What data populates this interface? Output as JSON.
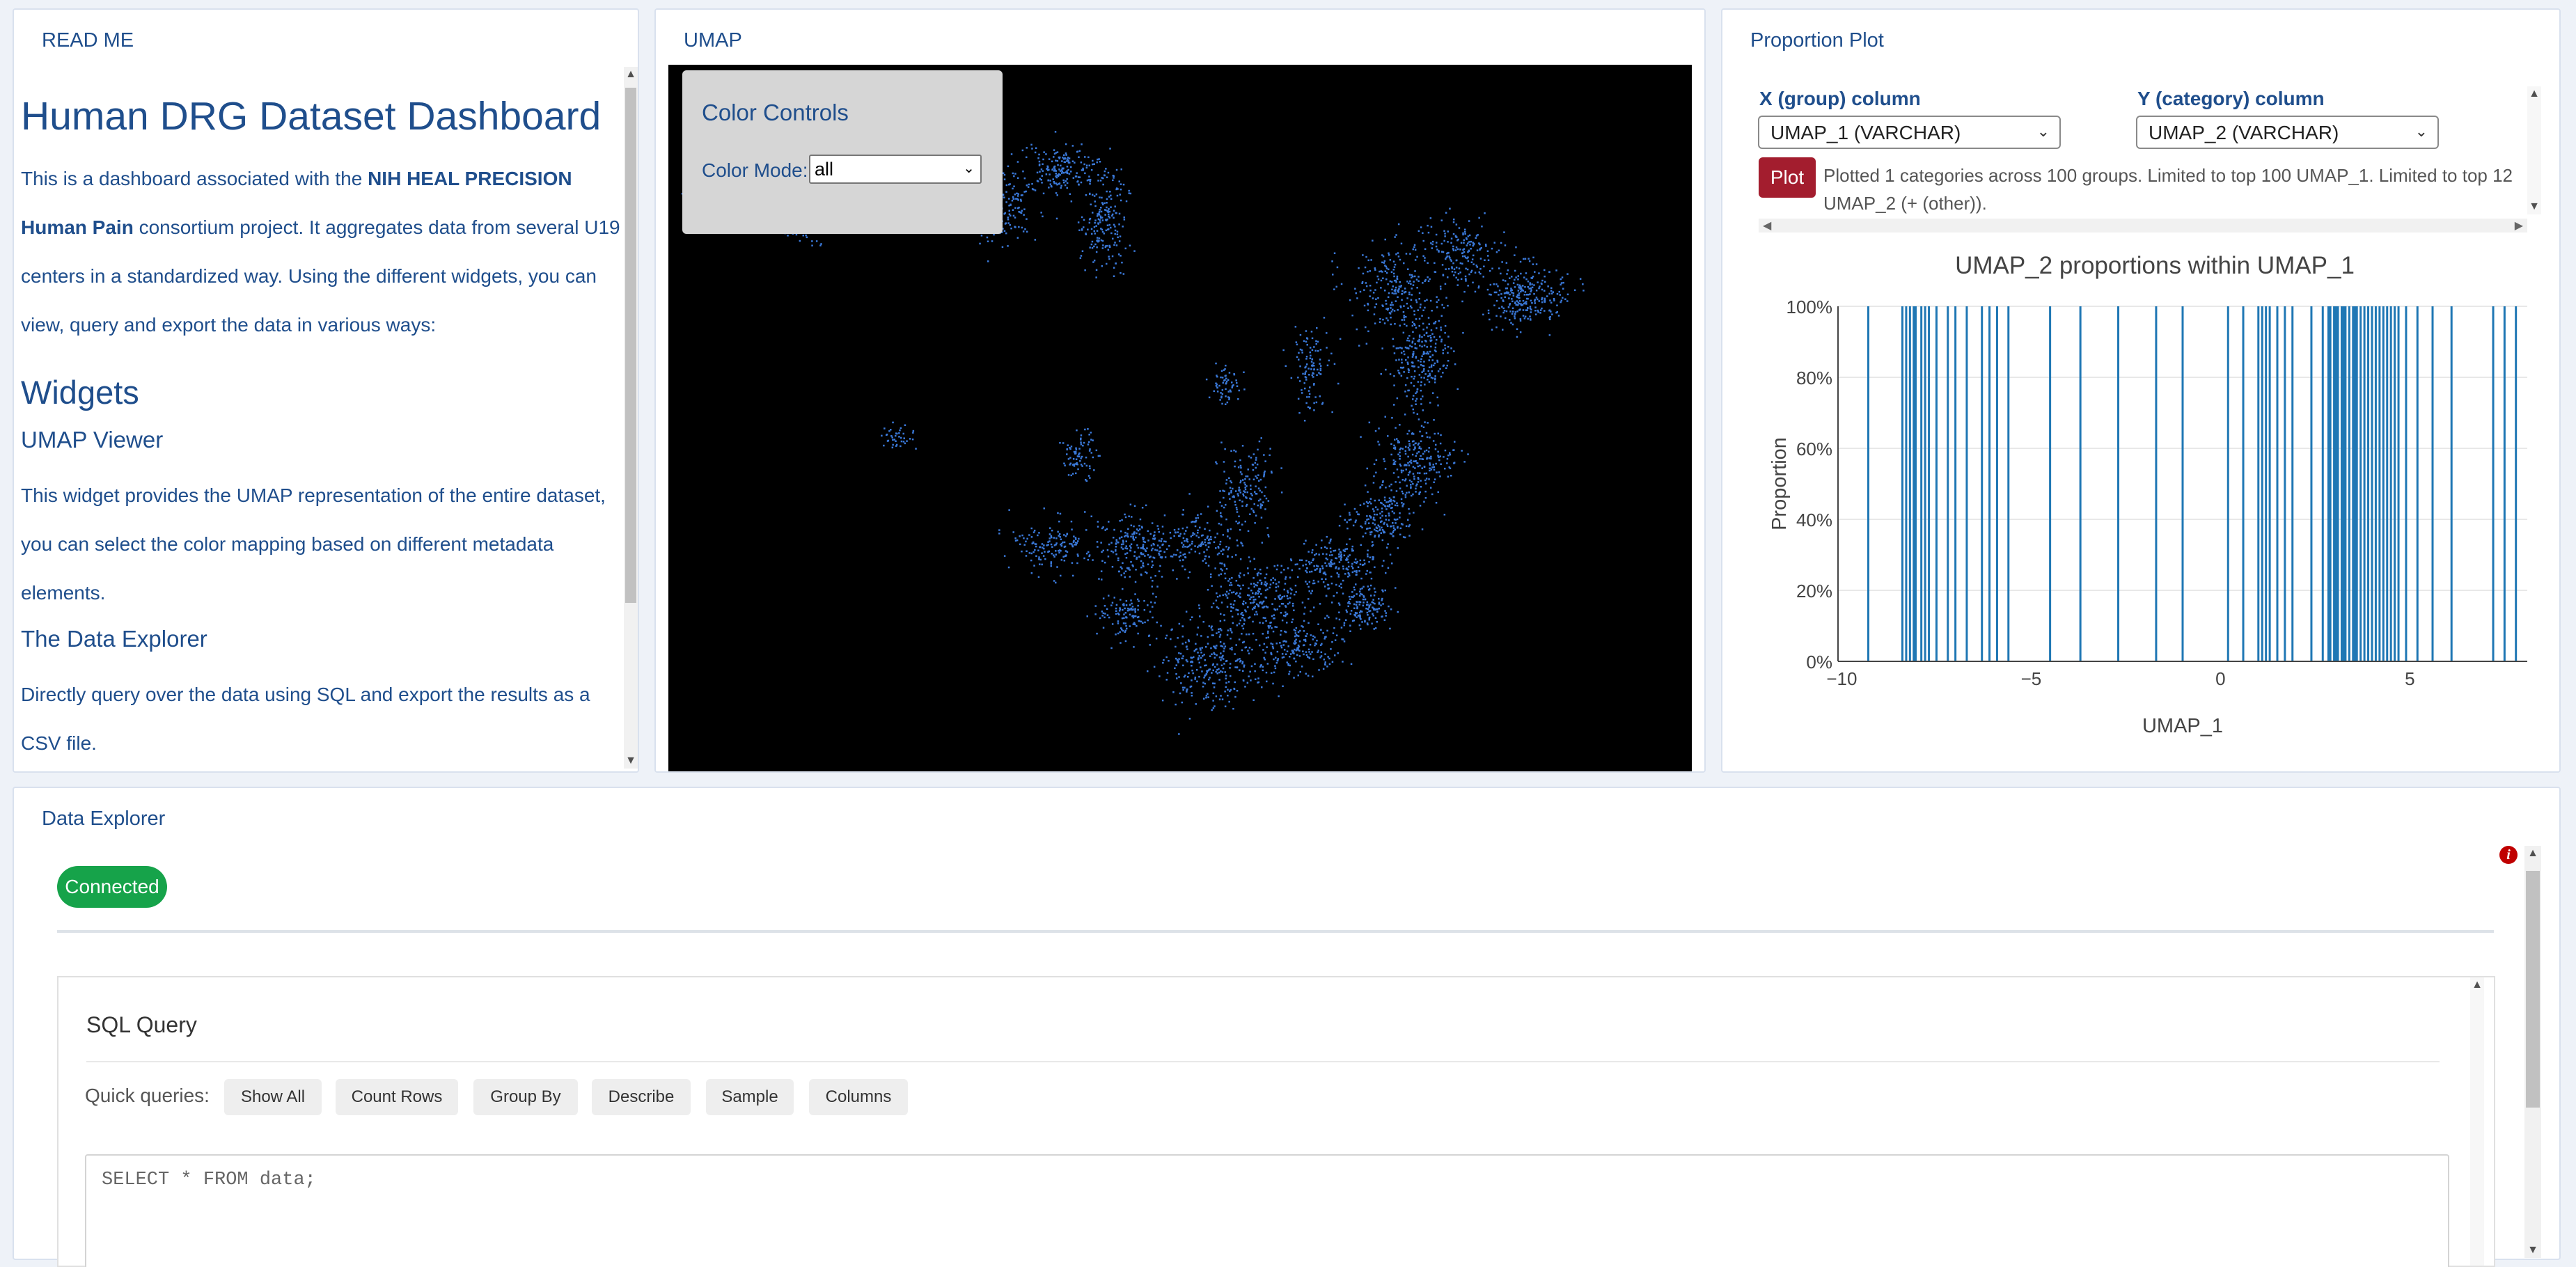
{
  "readme": {
    "title": "READ ME",
    "heading": "Human DRG Dataset Dashboard",
    "intro_prefix": "This is a dashboard associated with the ",
    "intro_bold": "NIH HEAL PRECISION Human Pain",
    "intro_suffix": " consortium project. It aggregates data from several U19 centers in a standardized way. Using the different widgets, you can view, query and export the data in various ways:",
    "widgets_heading": "Widgets",
    "umap_heading": "UMAP Viewer",
    "umap_text": "This widget provides the UMAP representation of the entire dataset, you can select the color mapping based on different metadata elements.",
    "explorer_heading": "The Data Explorer",
    "explorer_text": "Directly query over the data using SQL and export the results as a CSV file."
  },
  "umap": {
    "title": "UMAP",
    "controls_title": "Color Controls",
    "color_mode_label": "Color Mode:",
    "color_mode_value": "all",
    "point_color": "#3a78d8"
  },
  "proportion": {
    "title": "Proportion Plot",
    "x_label": "X (group) column",
    "x_value": "UMAP_1 (VARCHAR)",
    "y_label": "Y (category) column",
    "y_value": "UMAP_2 (VARCHAR)",
    "plot_button": "Plot",
    "status": "Plotted 1 categories across 100 groups. Limited to top 100 UMAP_1. Limited to top 12 UMAP_2 (+ (other)).",
    "colors": {
      "plot_button": "#a31d2e",
      "bars": "#1f77b4"
    }
  },
  "chart_data": {
    "type": "bar",
    "title": "UMAP_2 proportions within UMAP_1",
    "xlabel": "UMAP_1",
    "ylabel": "Proportion",
    "xlim": [
      -10.1,
      8.1
    ],
    "ylim": [
      0,
      1
    ],
    "xticks": [
      "−10",
      "−5",
      "0",
      "5"
    ],
    "yticks": [
      "0%",
      "20%",
      "40%",
      "60%",
      "80%",
      "100%"
    ],
    "grid": true,
    "series": [
      {
        "x": [
          -9.3,
          -8.4,
          -8.3,
          -8.2,
          -8.1,
          -8.05,
          -7.9,
          -7.8,
          -7.7,
          -7.5,
          -7.2,
          -7.0,
          -6.7,
          -6.3,
          -6.1,
          -5.9,
          -5.6,
          -4.5,
          -3.7,
          -2.7,
          -1.7,
          -1.0,
          0.2,
          0.6,
          1.0,
          1.1,
          1.2,
          1.3,
          1.5,
          1.7,
          1.9,
          2.4,
          2.7,
          2.85,
          2.9,
          3.0,
          3.05,
          3.1,
          3.2,
          3.25,
          3.3,
          3.4,
          3.5,
          3.55,
          3.6,
          3.7,
          3.8,
          3.9,
          4.0,
          4.1,
          4.2,
          4.3,
          4.4,
          4.5,
          4.6,
          4.7,
          4.9,
          5.2,
          5.6,
          6.1,
          7.2,
          7.5,
          7.8
        ],
        "values": [
          1,
          1,
          1,
          1,
          1,
          1,
          1,
          1,
          1,
          1,
          1,
          1,
          1,
          1,
          1,
          1,
          1,
          1,
          1,
          1,
          1,
          1,
          1,
          1,
          1,
          1,
          1,
          1,
          1,
          1,
          1,
          1,
          1,
          1,
          1,
          1,
          1,
          1,
          1,
          1,
          1,
          1,
          1,
          1,
          1,
          1,
          1,
          1,
          1,
          1,
          1,
          1,
          1,
          1,
          1,
          1,
          1,
          1,
          1,
          1,
          1,
          1,
          1
        ]
      }
    ]
  },
  "explorer": {
    "title": "Data Explorer",
    "status": "Connected",
    "sql_title": "SQL Query",
    "quick_label": "Quick queries:",
    "quick_queries": [
      "Show All",
      "Count Rows",
      "Group By",
      "Describe",
      "Sample",
      "Columns"
    ],
    "query_text": "SELECT * FROM data;",
    "colors": {
      "connected": "#16a34a",
      "alert": "#c00000"
    }
  }
}
